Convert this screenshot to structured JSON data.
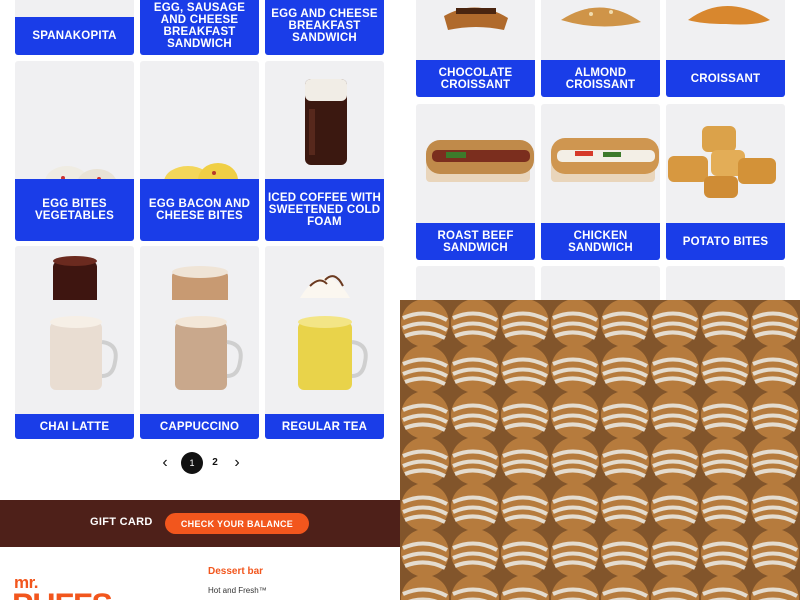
{
  "menu_grid": {
    "items": [
      {
        "label": "Spanakopita"
      },
      {
        "label": "Egg, Sausage and Cheese Breakfast Sandwich"
      },
      {
        "label": "Egg and Cheese Breakfast Sandwich"
      },
      {
        "label": "Egg Bites Vegetables"
      },
      {
        "label": "Egg Bacon and Cheese Bites"
      },
      {
        "label": "Iced Coffee with Sweetened Cold Foam"
      },
      {
        "label": "Chai Latte"
      },
      {
        "label": "Cappuccino"
      },
      {
        "label": "Regular Tea"
      }
    ]
  },
  "pagination": {
    "prev": "‹",
    "page1": "1",
    "page2": "2",
    "next": "›",
    "current": 1
  },
  "gift_card": {
    "label": "GIFT CARD",
    "button": "CHECK YOUR BALANCE"
  },
  "footer": {
    "logo_mr": "mr.",
    "logo_puffs": "PUFFS",
    "heading": "Dessert bar",
    "link": "Hot and Fresh™"
  },
  "right_grid": {
    "items": [
      {
        "label": "Chocolate Croissant"
      },
      {
        "label": "Almond Croissant"
      },
      {
        "label": "Croissant"
      },
      {
        "label": "Roast Beef Sandwich"
      },
      {
        "label": "Chicken Sandwich"
      },
      {
        "label": "Potato Bites"
      }
    ]
  },
  "colors": {
    "brand_blue": "#1a3de8",
    "brand_orange": "#f2561d",
    "gift_bar": "#4e2019"
  }
}
